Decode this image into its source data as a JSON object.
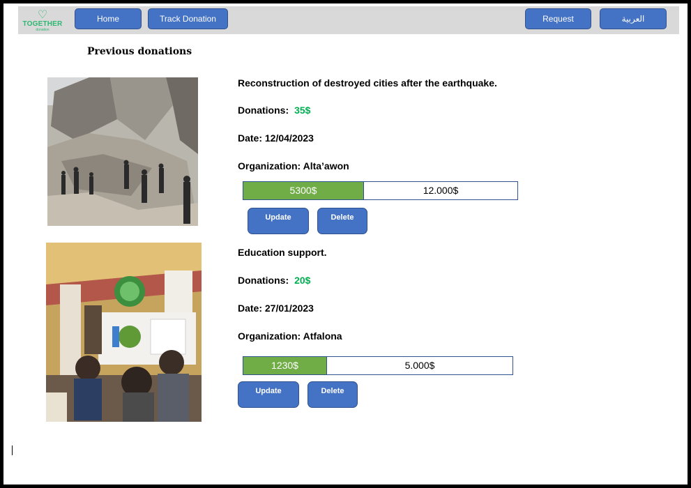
{
  "navbar": {
    "logo_text": "TOGETHER",
    "logo_subtext": "donation",
    "home_label": "Home",
    "track_label": "Track Donation",
    "request_label": "Request",
    "language_label": "العربية"
  },
  "page": {
    "heading": "Previous donations"
  },
  "donations": [
    {
      "title": "Reconstruction of destroyed cities after the earthquake.",
      "donations_label": "Donations:",
      "donation_amount": "35$",
      "date": "Date: 12/04/2023",
      "organization": "Organization: Alta’awon",
      "raised": "5300$",
      "goal": "12.000$",
      "progress_fraction": 0.44,
      "update_label": "Update",
      "delete_label": "Delete",
      "image": "earthquake-rubble-photo"
    },
    {
      "title": "Education support.",
      "donations_label": "Donations:",
      "donation_amount": "20$",
      "date": "Date: 27/01/2023",
      "organization": "Organization: Atfalona",
      "raised": "1230$",
      "goal": "5.000$",
      "progress_fraction": 0.31,
      "update_label": "Update",
      "delete_label": "Delete",
      "image": "classroom-tent-photo"
    }
  ],
  "colors": {
    "accent_button": "#4472c4",
    "progress_fill": "#70ad47",
    "amount_green": "#00b050",
    "navbar_bg": "#d9d9d9",
    "logo_green": "#2eb872"
  }
}
